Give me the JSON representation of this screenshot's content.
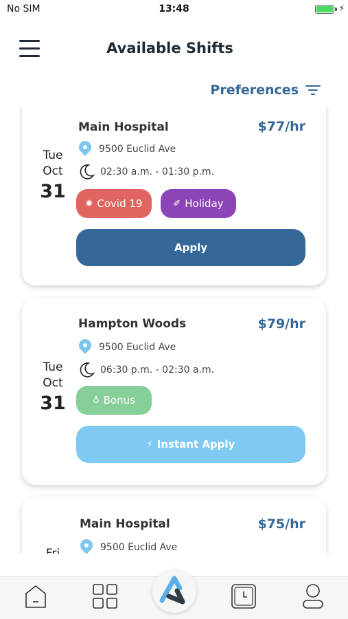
{
  "status_bar": {
    "carrier": "No SIM",
    "time": "13:48"
  },
  "header": {
    "title": "Available Shifts"
  },
  "preferences": {
    "label": "Preferences"
  },
  "shifts": [
    {
      "day_of_week": "Tue",
      "month": "Oct",
      "day": "31",
      "facility": "Main Hospital",
      "rate": "$77/hr",
      "address": "9500 Euclid Ave",
      "time_range": "02:30 a.m. - 01:30 p.m.",
      "tags": [
        {
          "label": "Covid 19",
          "color": "#e06460"
        },
        {
          "label": "Holiday",
          "color": "#8b45b8"
        }
      ],
      "action_label": "Apply",
      "action_color": "#356898"
    },
    {
      "day_of_week": "Tue",
      "month": "Oct",
      "day": "31",
      "facility": "Hampton Woods",
      "rate": "$79/hr",
      "address": "9500 Euclid Ave",
      "time_range": "06:30 p.m. - 02:30 a.m.",
      "tags": [
        {
          "label": "Bonus",
          "color": "#86cf98"
        }
      ],
      "action_label": "Instant Apply",
      "action_color": "#7ecaf2"
    },
    {
      "day_of_week": "Fri",
      "facility": "Main Hospital",
      "rate": "$75/hr",
      "address": "9500 Euclid Ave"
    }
  ],
  "colors": {
    "accent": "#356898",
    "pin": "#7ec6ee"
  },
  "nav": {
    "items": [
      "home-icon",
      "grid-icon",
      "logo-icon",
      "clock-icon",
      "profile-icon"
    ]
  }
}
